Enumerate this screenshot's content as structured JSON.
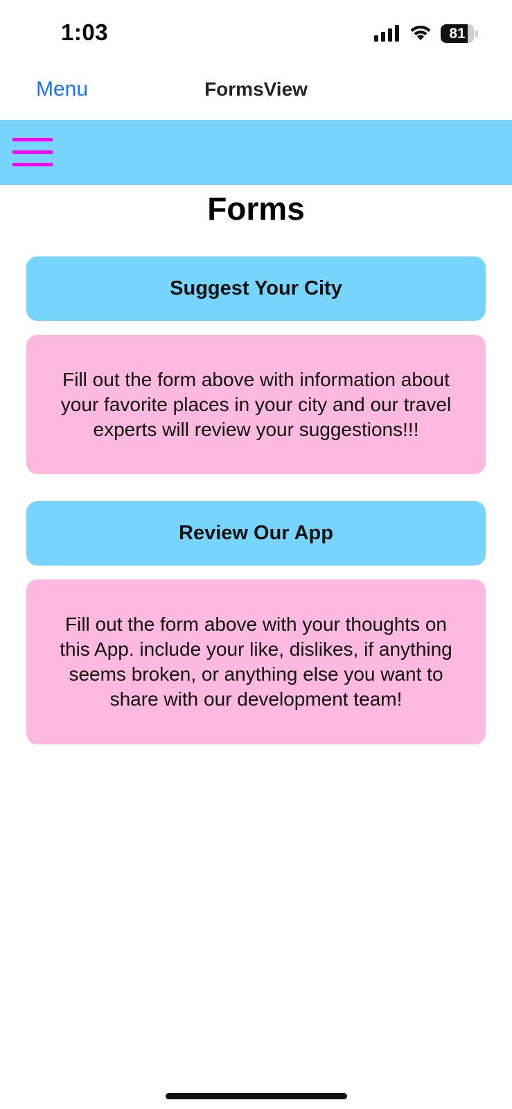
{
  "status_bar": {
    "time": "1:03",
    "battery_level": "81",
    "battery_fraction": 0.81
  },
  "nav": {
    "back_label": "Menu",
    "title": "FormsView"
  },
  "header": {
    "menu_icon": "hamburger-menu-icon",
    "accent_color": "#ff00ff",
    "band_color": "#77d4fd"
  },
  "page": {
    "title": "Forms"
  },
  "forms": [
    {
      "button_label": "Suggest Your City",
      "description": "Fill out the form above with information about your favorite places in your city and our travel experts will review your suggestions!!!"
    },
    {
      "button_label": "Review Our App",
      "description": "Fill out the form above with your thoughts on this App. include your like, dislikes, if anything seems broken, or anything else you want to share with our development team!"
    }
  ],
  "colors": {
    "button_bg": "#77d4fd",
    "card_bg": "#fdb9e0",
    "link": "#1a73e8"
  }
}
